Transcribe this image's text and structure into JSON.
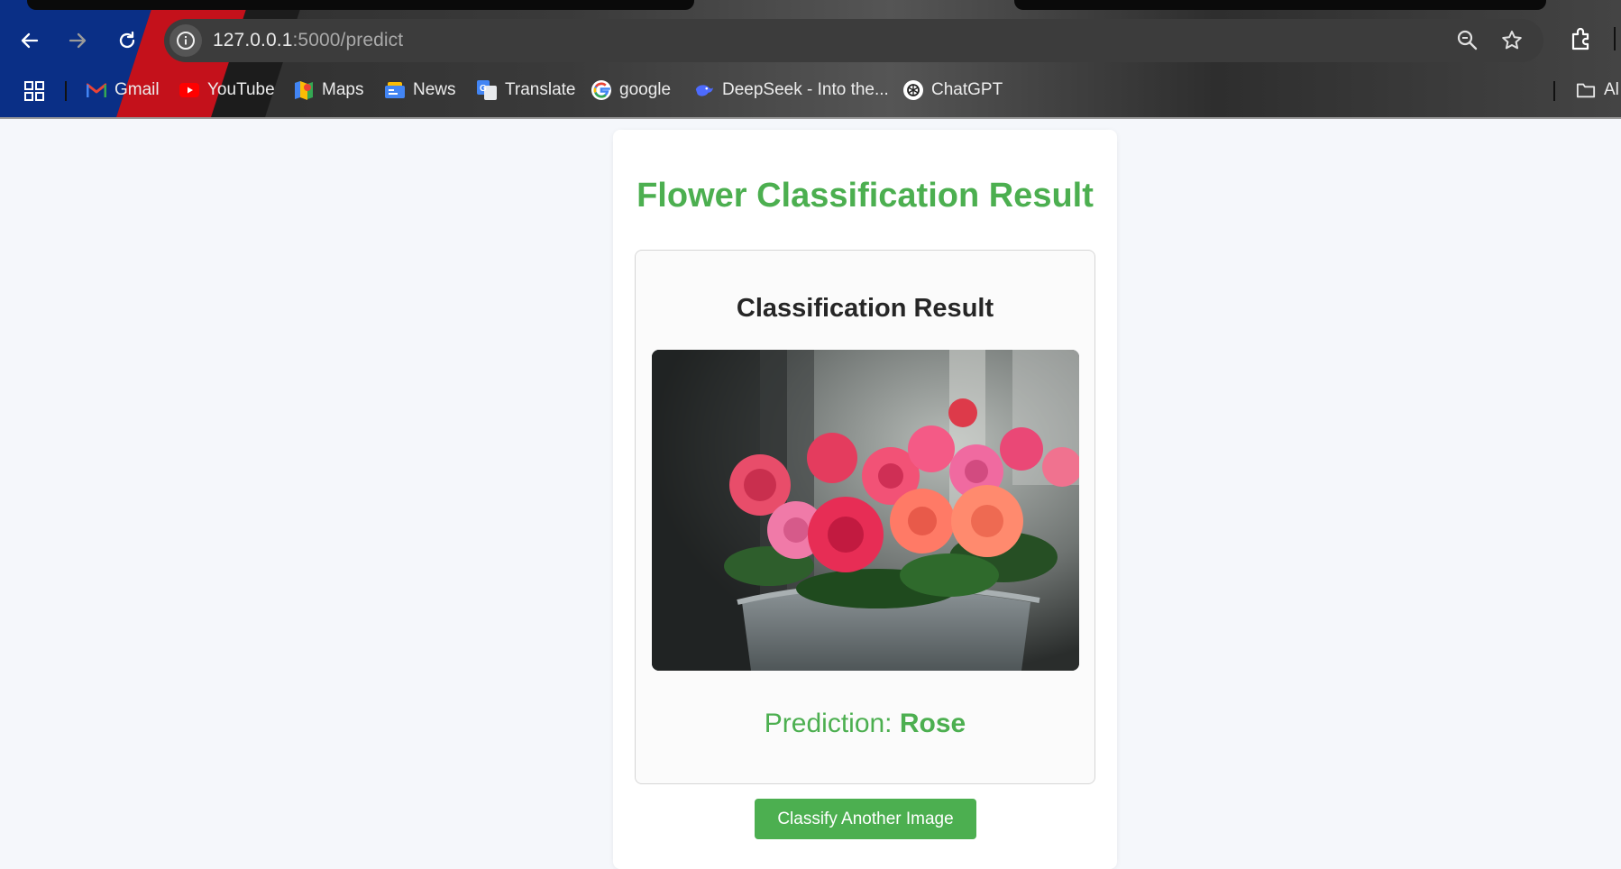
{
  "browser": {
    "url_host": "127.0.0.1",
    "url_path": ":5000/predict",
    "bookmarks": [
      {
        "label": "Gmail",
        "icon": "gmail-icon"
      },
      {
        "label": "YouTube",
        "icon": "youtube-icon"
      },
      {
        "label": "Maps",
        "icon": "maps-icon"
      },
      {
        "label": "News",
        "icon": "news-icon"
      },
      {
        "label": "Translate",
        "icon": "translate-icon"
      },
      {
        "label": "google",
        "icon": "google-icon"
      },
      {
        "label": "DeepSeek - Into the...",
        "icon": "deepseek-icon"
      },
      {
        "label": "ChatGPT",
        "icon": "chatgpt-icon"
      }
    ],
    "all_bookmarks_label": "Al"
  },
  "page": {
    "title": "Flower Classification Result",
    "result_heading": "Classification Result",
    "image_alt": "Uploaded flower image",
    "prediction_label": "Prediction: ",
    "prediction_value": "Rose",
    "again_button": "Classify Another Image"
  },
  "colors": {
    "accent": "#4caf50",
    "heading": "#262626",
    "page_bg": "#f5f7fb"
  }
}
